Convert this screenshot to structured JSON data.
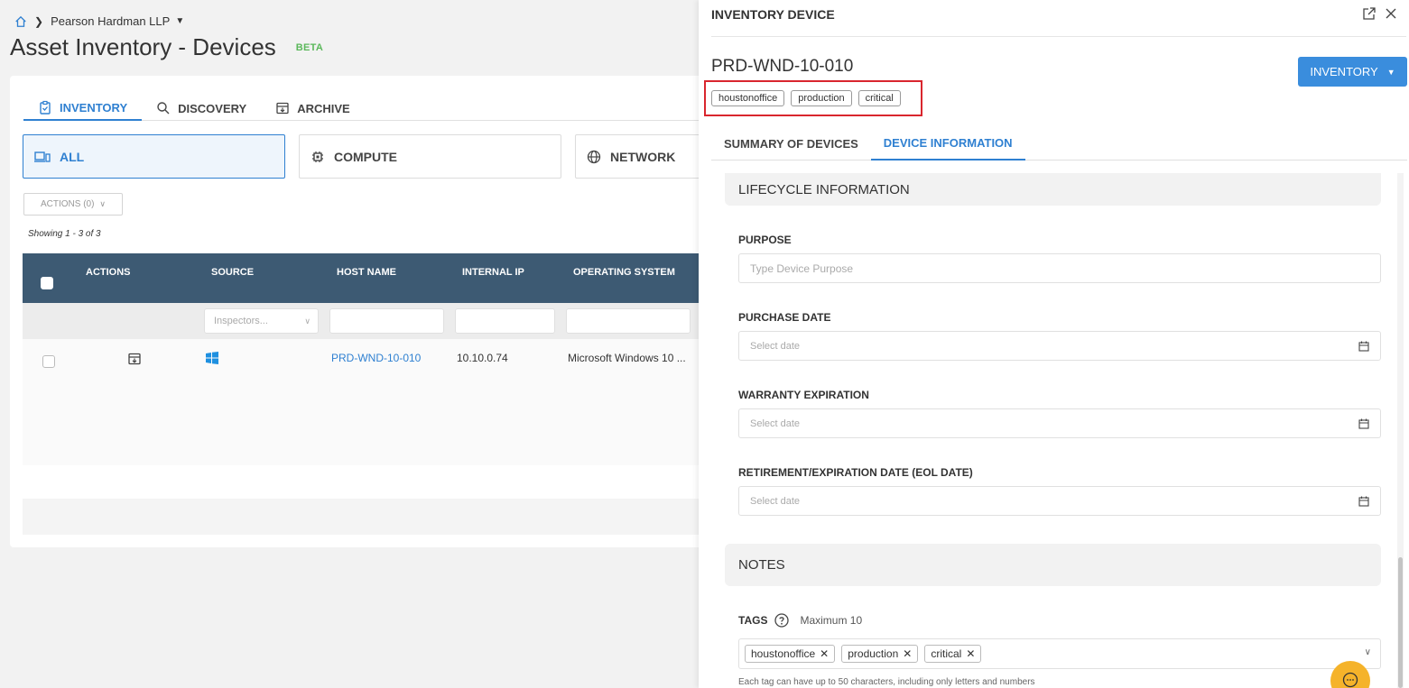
{
  "breadcrumb": {
    "org": "Pearson Hardman LLP"
  },
  "page": {
    "title": "Asset Inventory - Devices",
    "badge": "BETA"
  },
  "tabs": [
    {
      "label": "INVENTORY",
      "icon": "clipboard-icon"
    },
    {
      "label": "DISCOVERY",
      "icon": "search-icon"
    },
    {
      "label": "ARCHIVE",
      "icon": "archive-icon"
    }
  ],
  "filter_cards": [
    {
      "label": "ALL",
      "icon": "devices-icon"
    },
    {
      "label": "COMPUTE",
      "icon": "chip-icon"
    },
    {
      "label": "NETWORK",
      "icon": "globe-icon"
    }
  ],
  "actions_button": "ACTIONS (0)",
  "showing": "Showing 1 - 3 of 3",
  "table": {
    "headers": [
      "ACTIONS",
      "SOURCE",
      "HOST NAME",
      "INTERNAL IP",
      "OPERATING SYSTEM"
    ],
    "source_filter_placeholder": "Inspectors...",
    "rows": [
      {
        "host_name": "PRD-WND-10-010",
        "internal_ip": "10.10.0.74",
        "os": "Microsoft Windows 10 ...",
        "source_icon": "windows-icon"
      }
    ]
  },
  "drawer": {
    "header": "INVENTORY DEVICE",
    "device_name": "PRD-WND-10-010",
    "inventory_button": "INVENTORY",
    "tags": [
      "houstonoffice",
      "production",
      "critical"
    ],
    "tabs": [
      "SUMMARY OF DEVICES",
      "DEVICE INFORMATION"
    ],
    "lifecycle_title": "LIFECYCLE INFORMATION",
    "purpose_label": "PURPOSE",
    "purpose_placeholder": "Type Device Purpose",
    "purchase_label": "PURCHASE DATE",
    "warranty_label": "WARRANTY EXPIRATION",
    "retirement_label": "RETIREMENT/EXPIRATION DATE (EOL DATE)",
    "date_placeholder": "Select date",
    "notes_title": "NOTES",
    "tags_label": "TAGS",
    "tags_max": "Maximum 10",
    "tags_help": "Each tag can have up to 50 characters, including only letters and numbers"
  },
  "colors": {
    "accent": "#2f80d1",
    "header_bg": "#3d5a73",
    "highlight": "#d9262e",
    "chat": "#f5b32a",
    "beta": "#5bb85b"
  }
}
